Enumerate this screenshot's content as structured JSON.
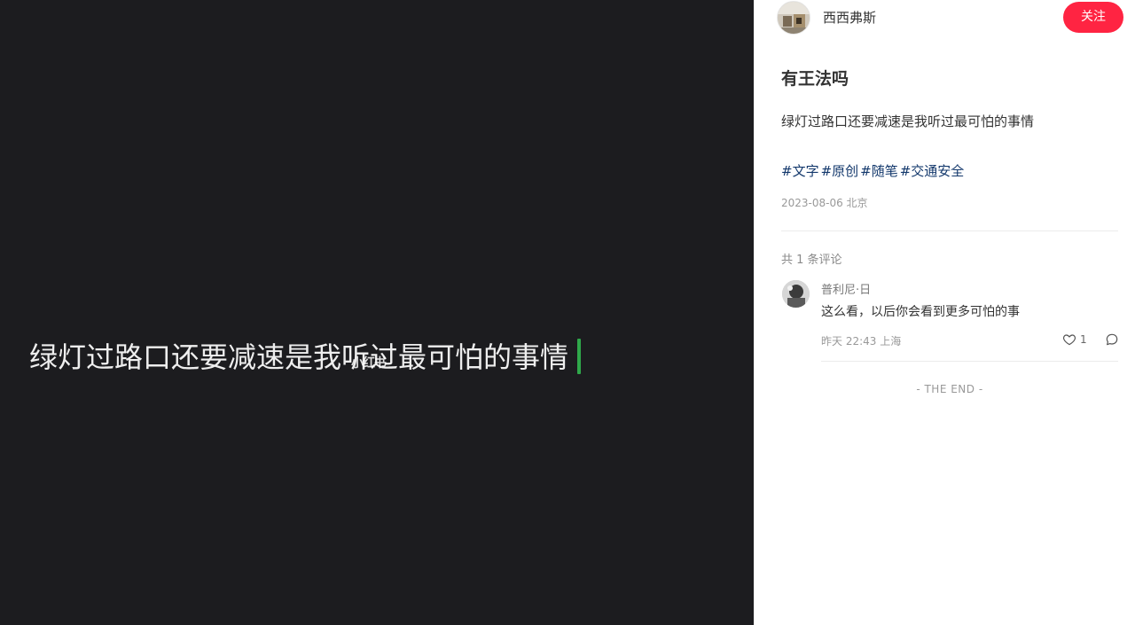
{
  "media": {
    "caption": "绿灯过路口还要减速是我听过最可怕的事情",
    "watermark": "小红书"
  },
  "author": {
    "name": "西西弗斯",
    "follow_label": "关注"
  },
  "note": {
    "title": "有王法吗",
    "description": "绿灯过路口还要减速是我听过最可怕的事情",
    "tags": [
      "#文字",
      "#原创",
      "#随笔",
      "#交通安全"
    ],
    "meta": "2023-08-06 北京"
  },
  "comments": {
    "count_label": "共 1 条评论",
    "items": [
      {
        "user": "普利尼·日",
        "text": "这么看，以后你会看到更多可怕的事",
        "meta": "昨天 22:43 上海",
        "likes": "1"
      }
    ]
  },
  "end_label": "- THE END -",
  "colors": {
    "accent": "#ff2442",
    "tag": "#13386c",
    "media_bg": "#1c1c1f",
    "cursor": "#2fa84a"
  },
  "icons": [
    "heart-icon",
    "comment-icon"
  ]
}
